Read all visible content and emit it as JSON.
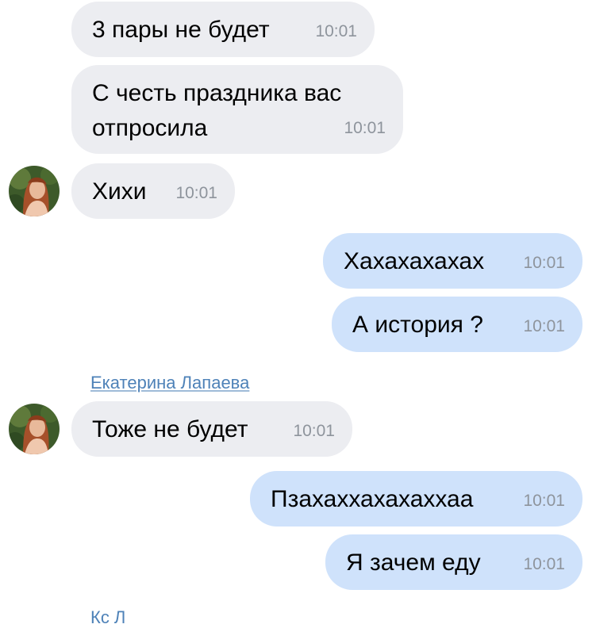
{
  "messages": [
    {
      "text": "3 пары не будет",
      "time": "10:01",
      "dir": "in"
    },
    {
      "text": "С честь праздника вас отпросила",
      "time": "10:01",
      "dir": "in"
    },
    {
      "text": "Хихи",
      "time": "10:01",
      "dir": "in"
    },
    {
      "text": "Хахахахахах",
      "time": "10:01",
      "dir": "out"
    },
    {
      "text": "А история ?",
      "time": "10:01",
      "dir": "out"
    },
    {
      "text": "Тоже не будет",
      "time": "10:01",
      "dir": "in"
    },
    {
      "text": "Пзахаххахахаххаа",
      "time": "10:01",
      "dir": "out"
    },
    {
      "text": "Я зачем еду",
      "time": "10:01",
      "dir": "out"
    }
  ],
  "sender_name": "Екатерина Лапаева",
  "truncated_sender_name": "Кс  Л",
  "colors": {
    "incoming_bubble": "#ecedf1",
    "outgoing_bubble": "#cfe2fb",
    "sender_link": "#4e82b8",
    "timestamp": "#8e949c"
  },
  "icons": {
    "avatar": "user-avatar-photo"
  }
}
